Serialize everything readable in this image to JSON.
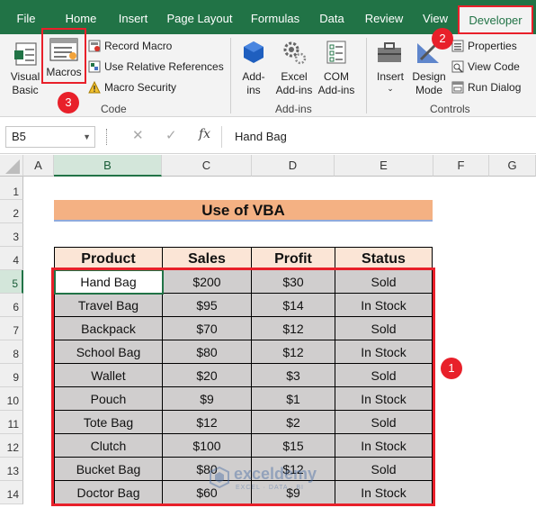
{
  "ribbon_tabs": [
    "File",
    "Home",
    "Insert",
    "Page Layout",
    "Formulas",
    "Data",
    "Review",
    "View",
    "Developer"
  ],
  "code_group": {
    "visual_basic": [
      "Visual",
      "Basic"
    ],
    "macros": "Macros",
    "record_macro": "Record Macro",
    "relative_refs": "Use Relative References",
    "macro_security": "Macro Security",
    "name": "Code"
  },
  "addins_group": {
    "addins": [
      "Add-",
      "ins"
    ],
    "excel_addins": [
      "Excel",
      "Add-ins"
    ],
    "com_addins": [
      "COM",
      "Add-ins"
    ],
    "name": "Add-ins"
  },
  "controls_group": {
    "insert": "Insert",
    "design_mode": [
      "Design",
      "Mode"
    ],
    "properties": "Properties",
    "view_code": "View Code",
    "run_dialog": "Run Dialog",
    "name": "Controls"
  },
  "formula_bar": {
    "name_box": "B5",
    "cancel": "✕",
    "enter": "✓",
    "fx": "fx",
    "value": "Hand Bag"
  },
  "columns": [
    "A",
    "B",
    "C",
    "D",
    "E",
    "F",
    "G"
  ],
  "rows": [
    "1",
    "2",
    "3",
    "4",
    "5",
    "6",
    "7",
    "8",
    "9",
    "10",
    "11",
    "12",
    "13",
    "14"
  ],
  "sheet_title": "Use of VBA",
  "table": {
    "headers": [
      "Product",
      "Sales",
      "Profit",
      "Status"
    ],
    "rows": [
      [
        "Hand Bag",
        "$200",
        "$30",
        "Sold"
      ],
      [
        "Travel Bag",
        "$95",
        "$14",
        "In Stock"
      ],
      [
        "Backpack",
        "$70",
        "$12",
        "Sold"
      ],
      [
        "School Bag",
        "$80",
        "$12",
        "In Stock"
      ],
      [
        "Wallet",
        "$20",
        "$3",
        "Sold"
      ],
      [
        "Pouch",
        "$9",
        "$1",
        "In Stock"
      ],
      [
        "Tote Bag",
        "$12",
        "$2",
        "Sold"
      ],
      [
        "Clutch",
        "$100",
        "$15",
        "In Stock"
      ],
      [
        "Bucket Bag",
        "$80",
        "$12",
        "Sold"
      ],
      [
        "Doctor Bag",
        "$60",
        "$9",
        "In Stock"
      ]
    ]
  },
  "step_markers": [
    "1",
    "2",
    "3"
  ],
  "watermark": {
    "name": "exceldemy",
    "tagline": "EXCEL · DATA · BI"
  },
  "colors": {
    "excel_green": "#217346",
    "marker_red": "#e8202a",
    "header_fill": "#fbe5d6",
    "title_fill": "#f4b183",
    "data_fill": "#d0cece"
  }
}
